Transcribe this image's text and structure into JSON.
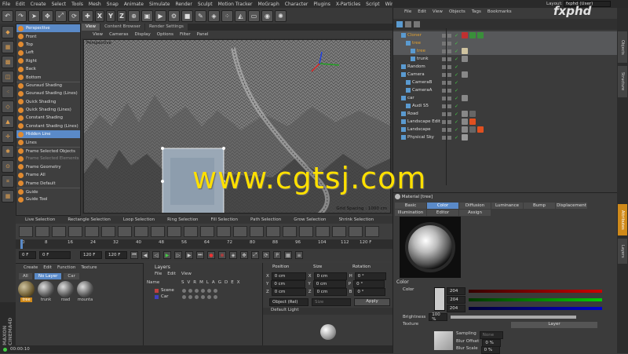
{
  "menubar": [
    "File",
    "Edit",
    "Create",
    "Select",
    "Tools",
    "Mesh",
    "Snap",
    "Animate",
    "Simulate",
    "Render",
    "Sculpt",
    "Motion Tracker",
    "MoGraph",
    "Character",
    "Plugins",
    "X-Particles",
    "Script",
    "Window",
    "Help"
  ],
  "toolbar_axes": [
    "X",
    "Y",
    "Z"
  ],
  "view_menu": {
    "items": [
      {
        "label": "Perspective",
        "selected": true
      },
      {
        "label": "Front"
      },
      {
        "label": "Top"
      },
      {
        "label": "Left"
      },
      {
        "label": "Right"
      },
      {
        "label": "Back"
      },
      {
        "label": "Bottom"
      },
      {
        "label": "Gouraud Shading",
        "sep": true
      },
      {
        "label": "Gouraud Shading (Lines)"
      },
      {
        "label": "Quick Shading"
      },
      {
        "label": "Quick Shading (Lines)"
      },
      {
        "label": "Constant Shading"
      },
      {
        "label": "Constant Shading (Lines)"
      },
      {
        "label": "Hidden Line",
        "selected": true
      },
      {
        "label": "Lines"
      },
      {
        "label": "Frame Selected Objects",
        "sep": true
      },
      {
        "label": "Frame Selected Elements",
        "dim": true
      },
      {
        "label": "Frame Geometry"
      },
      {
        "label": "Frame All"
      },
      {
        "label": "Frame Default"
      },
      {
        "label": "Guide",
        "sep": true
      },
      {
        "label": "Guide Tool"
      }
    ]
  },
  "viewport": {
    "tabs": [
      "View",
      "Content Browser",
      "Render Settings"
    ],
    "menu": [
      "View",
      "Cameras",
      "Display",
      "Options",
      "Filter",
      "Panel"
    ],
    "title": "Perspective",
    "grid_spacing": "Grid Spacing : 1000 cm"
  },
  "watermark": "www.cgtsj.com",
  "fxphd": "fxphd",
  "layout": {
    "label": "Layout:",
    "value": "fxphd (User)"
  },
  "anim_bar": [
    "Live Selection",
    "Rectangle Selection",
    "Loop Selection",
    "Ring Selection",
    "Fill Selection",
    "Path Selection",
    "Grow Selection",
    "Shrink Selection"
  ],
  "timeline": {
    "ticks": [
      "0",
      "8",
      "16",
      "24",
      "32",
      "40",
      "48",
      "56",
      "64",
      "72",
      "80",
      "88",
      "96",
      "104",
      "112"
    ],
    "end": "120 F"
  },
  "transport": {
    "current": "0 F",
    "start": "0 F",
    "min": "120 F",
    "max": "120 F"
  },
  "material_manager": {
    "menu": [
      "Create",
      "Edit",
      "Function",
      "Texture"
    ],
    "tabs": [
      "All",
      "No Layer",
      "Car"
    ],
    "materials": [
      {
        "name": "tree",
        "selected": true
      },
      {
        "name": "trunk"
      },
      {
        "name": "road"
      },
      {
        "name": "mounta"
      }
    ]
  },
  "layers": {
    "title": "Layers",
    "menu": [
      "File",
      "Edit",
      "View"
    ],
    "columns": [
      "Name",
      "S",
      "V",
      "R",
      "M",
      "L",
      "A",
      "G",
      "D",
      "E",
      "X"
    ],
    "rows": [
      {
        "name": "Scene",
        "color": "#c04040"
      },
      {
        "name": "Car",
        "color": "#4040c0"
      }
    ]
  },
  "coords": {
    "headers": [
      "Position",
      "Size",
      "Rotation"
    ],
    "rows": [
      {
        "axis": "X",
        "pos": "0 cm",
        "size": "0 cm",
        "rot_axis": "H",
        "rot": "0 °"
      },
      {
        "axis": "Y",
        "pos": "0 cm",
        "size": "0 cm",
        "rot_axis": "P",
        "rot": "0 °"
      },
      {
        "axis": "Z",
        "pos": "0 cm",
        "size": "0 cm",
        "rot_axis": "B",
        "rot": "0 °"
      }
    ],
    "mode": "Object (Rel)",
    "size_mode": "Size",
    "apply": "Apply",
    "default_light": "Default Light"
  },
  "object_manager": {
    "menu": [
      "File",
      "Edit",
      "View",
      "Objects",
      "Tags",
      "Bookmarks"
    ],
    "rows": [
      {
        "name": "Cloner",
        "indent": 0,
        "color": "#e0a030",
        "sel": true,
        "tags": [
          "#c03030",
          "#3a8f3a",
          "#3a8f3a"
        ]
      },
      {
        "name": "tree",
        "indent": 1,
        "color": "#e0a030",
        "sel": true,
        "tags": []
      },
      {
        "name": "tree",
        "indent": 2,
        "color": "#e0a030",
        "sel": true,
        "tags": [
          "#cfc3a0"
        ]
      },
      {
        "name": "trunk",
        "indent": 2,
        "color": "#ddd",
        "sel": false,
        "tags": [
          "#888"
        ]
      },
      {
        "name": "Random",
        "indent": 0,
        "color": "#ddd",
        "sel": false,
        "tags": []
      },
      {
        "name": "Camera",
        "indent": 0,
        "color": "#ddd",
        "sel": false,
        "tags": [
          "#888"
        ]
      },
      {
        "name": "CameraB",
        "indent": 1,
        "color": "#ddd",
        "sel": false,
        "tags": []
      },
      {
        "name": "CameraA",
        "indent": 1,
        "color": "#ddd",
        "sel": false,
        "tags": []
      },
      {
        "name": "car",
        "indent": 0,
        "color": "#ddd",
        "sel": false,
        "tags": [
          "#888"
        ]
      },
      {
        "name": "Audi S5",
        "indent": 1,
        "color": "#ddd",
        "sel": false,
        "tags": []
      },
      {
        "name": "Road",
        "indent": 0,
        "color": "#ddd",
        "sel": false,
        "tags": [
          "#888",
          "#666"
        ]
      },
      {
        "name": "Landscape Edit",
        "indent": 0,
        "color": "#ddd",
        "sel": false,
        "tags": [
          "#888",
          "#e05020"
        ]
      },
      {
        "name": "Landscape",
        "indent": 0,
        "color": "#ddd",
        "sel": false,
        "tags": [
          "#888",
          "#666",
          "#e05020"
        ]
      },
      {
        "name": "Physical Sky",
        "indent": 0,
        "color": "#ddd",
        "sel": false,
        "tags": [
          "#999"
        ]
      }
    ]
  },
  "attributes": {
    "header": "Material [tree]",
    "tabs": [
      "Basic",
      "Color",
      "Diffusion",
      "Luminance",
      "Bump",
      "Displacement",
      "Illumination",
      "Editor",
      "Assign"
    ],
    "active_tab": "Color",
    "section": "Color",
    "color_label": "Color",
    "r": "204",
    "g": "204",
    "b": "204",
    "brightness_label": "Brightness",
    "brightness": "100 %",
    "texture_label": "Texture",
    "texture_value": "Layer",
    "sampling_label": "Sampling",
    "sampling": "None",
    "blur_offset_label": "Blur Offset",
    "blur_offset": "0 %",
    "blur_scale_label": "Blur Scale",
    "blur_scale": "0 %"
  },
  "right_tabs": [
    "Objects",
    "Structure",
    "Attributes",
    "Layers"
  ],
  "status": {
    "time": "00:00:10"
  }
}
